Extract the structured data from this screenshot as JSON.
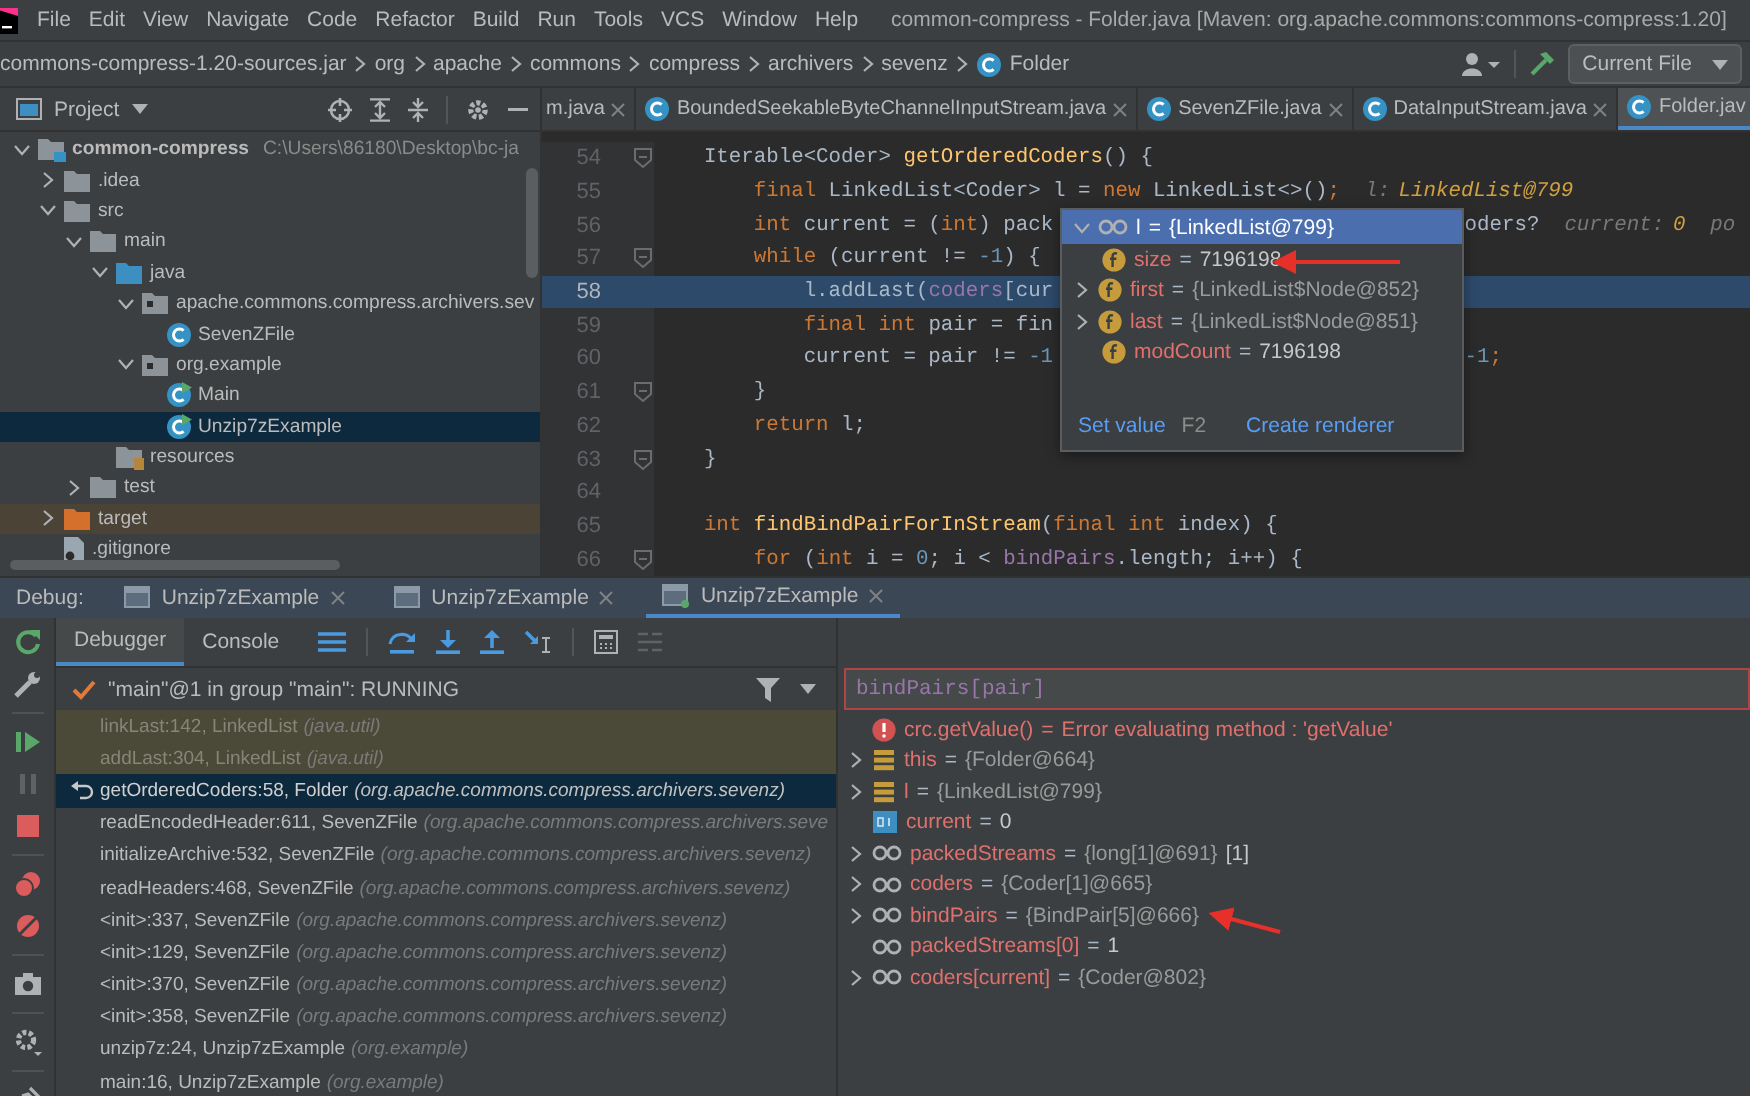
{
  "menu": {
    "items": [
      "File",
      "Edit",
      "View",
      "Navigate",
      "Code",
      "Refactor",
      "Build",
      "Run",
      "Tools",
      "VCS",
      "Window",
      "Help"
    ],
    "title": "common-compress - Folder.java [Maven: org.apache.commons:commons-compress:1.20]"
  },
  "breadcrumbs": [
    {
      "label": "commons-compress-1.20-sources.jar",
      "kind": "jar"
    },
    {
      "label": "org",
      "kind": "package"
    },
    {
      "label": "apache",
      "kind": "package"
    },
    {
      "label": "commons",
      "kind": "package"
    },
    {
      "label": "compress",
      "kind": "package"
    },
    {
      "label": "archivers",
      "kind": "package"
    },
    {
      "label": "sevenz",
      "kind": "package"
    },
    {
      "label": "Folder",
      "kind": "class"
    }
  ],
  "run_config": {
    "label": "Current File"
  },
  "project": {
    "title": "Project",
    "tree": [
      {
        "label": "common-compress",
        "path": "C:\\Users\\86180\\Desktop\\bc-ja",
        "kind": "module",
        "expanded": true,
        "selected": false,
        "children": [
          {
            "label": ".idea",
            "kind": "folder",
            "expanded": false,
            "selected": false
          },
          {
            "label": "src",
            "kind": "folder",
            "expanded": true,
            "selected": false,
            "children": [
              {
                "label": "main",
                "kind": "folder",
                "expanded": true,
                "selected": false,
                "children": [
                  {
                    "label": "java",
                    "kind": "source-root",
                    "expanded": true,
                    "selected": false,
                    "children": [
                      {
                        "label": "apache.commons.compress.archivers.sev",
                        "kind": "package",
                        "expanded": true,
                        "selected": false,
                        "children": [
                          {
                            "label": "SevenZFile",
                            "kind": "class",
                            "selected": false
                          }
                        ]
                      },
                      {
                        "label": "org.example",
                        "kind": "package",
                        "expanded": true,
                        "selected": false,
                        "children": [
                          {
                            "label": "Main",
                            "kind": "runnable-class",
                            "selected": false
                          },
                          {
                            "label": "Unzip7zExample",
                            "kind": "runnable-class",
                            "selected": true
                          }
                        ]
                      }
                    ]
                  },
                  {
                    "label": "resources",
                    "kind": "resources",
                    "selected": false
                  }
                ]
              },
              {
                "label": "test",
                "kind": "folder",
                "expanded": false,
                "selected": false
              }
            ]
          },
          {
            "label": "target",
            "kind": "excluded",
            "expanded": false,
            "selected": false
          },
          {
            "label": ".gitignore",
            "kind": "file",
            "selected": false
          }
        ]
      }
    ]
  },
  "editor_tabs": [
    {
      "label": "m.java",
      "icon_visible": false,
      "selected": false
    },
    {
      "label": "BoundedSeekableByteChannelInputStream.java",
      "icon_visible": true,
      "selected": false
    },
    {
      "label": "SevenZFile.java",
      "icon_visible": true,
      "selected": false
    },
    {
      "label": "DataInputStream.java",
      "icon_visible": true,
      "selected": false
    },
    {
      "label": "Folder.jav",
      "icon_visible": true,
      "selected": true
    }
  ],
  "code_lines": [
    {
      "number": "54",
      "fold": true,
      "execution_point": false,
      "tokens": [
        {
          "text": "    Iterable<Coder> ",
          "kind": "plain"
        },
        {
          "text": "getOrderedCoders",
          "kind": "method"
        },
        {
          "text": "() {",
          "kind": "plain"
        }
      ]
    },
    {
      "number": "55",
      "fold": false,
      "execution_point": false,
      "tokens": [
        {
          "text": "        final",
          "kind": "keyword"
        },
        {
          "text": " LinkedList<Coder> l = ",
          "kind": "plain"
        },
        {
          "text": "new",
          "kind": "keyword"
        },
        {
          "text": " LinkedList<>()",
          "kind": "plain"
        },
        {
          "text": ";",
          "kind": "keyword"
        },
        {
          "text": "l:",
          "kind": "hint"
        },
        {
          "text": "LinkedList@799",
          "kind": "hint-value"
        }
      ]
    },
    {
      "number": "56",
      "fold": false,
      "execution_point": false,
      "tokens": [
        {
          "text": "        int",
          "kind": "keyword"
        },
        {
          "text": " current = (",
          "kind": "plain"
        },
        {
          "text": "int",
          "kind": "keyword"
        },
        {
          "text": ") pack",
          "kind": "plain"
        }
      ],
      "tail": [
        {
          "text": "oders?",
          "kind": "plain"
        },
        {
          "text": "current:",
          "kind": "hint"
        },
        {
          "text": "0",
          "kind": "hint-value"
        },
        {
          "text": "po",
          "kind": "hint"
        }
      ]
    },
    {
      "number": "57",
      "fold": true,
      "execution_point": false,
      "tokens": [
        {
          "text": "        while",
          "kind": "keyword"
        },
        {
          "text": " (current != ",
          "kind": "plain"
        },
        {
          "text": "-1",
          "kind": "number"
        },
        {
          "text": ") {",
          "kind": "plain"
        }
      ]
    },
    {
      "number": "58",
      "fold": false,
      "execution_point": true,
      "tokens": [
        {
          "text": "            l.addLast(",
          "kind": "plain"
        },
        {
          "text": "coders",
          "kind": "field"
        },
        {
          "text": "[cur",
          "kind": "plain"
        }
      ]
    },
    {
      "number": "59",
      "fold": false,
      "execution_point": false,
      "tokens": [
        {
          "text": "            final int",
          "kind": "keyword"
        },
        {
          "text": " pair = fin",
          "kind": "plain"
        }
      ]
    },
    {
      "number": "60",
      "fold": false,
      "execution_point": false,
      "tokens": [
        {
          "text": "            current = pair != ",
          "kind": "plain"
        },
        {
          "text": "-1",
          "kind": "number"
        }
      ],
      "tail": [
        {
          "text": "-1",
          "kind": "number"
        },
        {
          "text": ";",
          "kind": "keyword"
        }
      ]
    },
    {
      "number": "61",
      "fold": true,
      "execution_point": false,
      "tokens": [
        {
          "text": "        }",
          "kind": "plain"
        }
      ]
    },
    {
      "number": "62",
      "fold": false,
      "execution_point": false,
      "tokens": [
        {
          "text": "        return",
          "kind": "keyword"
        },
        {
          "text": " l;",
          "kind": "plain"
        }
      ]
    },
    {
      "number": "63",
      "fold": true,
      "execution_point": false,
      "tokens": [
        {
          "text": "    }",
          "kind": "plain"
        }
      ]
    },
    {
      "number": "64",
      "fold": false,
      "execution_point": false
    },
    {
      "number": "65",
      "fold": false,
      "execution_point": false,
      "tokens": [
        {
          "text": "    int ",
          "kind": "keyword"
        },
        {
          "text": "findBindPairForInStream",
          "kind": "method"
        },
        {
          "text": "(",
          "kind": "plain"
        },
        {
          "text": "final int",
          "kind": "keyword"
        },
        {
          "text": " index) {",
          "kind": "plain"
        }
      ]
    },
    {
      "number": "66",
      "fold": true,
      "execution_point": false,
      "tokens": [
        {
          "text": "        for",
          "kind": "keyword"
        },
        {
          "text": " (",
          "kind": "plain"
        },
        {
          "text": "int",
          "kind": "keyword"
        },
        {
          "text": " i = ",
          "kind": "plain"
        },
        {
          "text": "0",
          "kind": "number"
        },
        {
          "text": "; i < ",
          "kind": "plain"
        },
        {
          "text": "bindPairs",
          "kind": "field"
        },
        {
          "text": ".length; i++) {",
          "kind": "plain"
        }
      ]
    }
  ],
  "popup": {
    "name": "l",
    "separator": "=",
    "value": "{LinkedList@799}",
    "expanded": true,
    "fields": [
      {
        "name": "size",
        "separator": "=",
        "value": "7196198",
        "expandable": false,
        "object": false
      },
      {
        "name": "first",
        "separator": "=",
        "value": "{LinkedList$Node@852}",
        "expandable": true,
        "object": true
      },
      {
        "name": "last",
        "separator": "=",
        "value": "{LinkedList$Node@851}",
        "expandable": true,
        "object": true
      },
      {
        "name": "modCount",
        "separator": "=",
        "value": "7196198",
        "expandable": false,
        "object": false
      }
    ],
    "actions": [
      {
        "label": "Set value",
        "shortcut": "F2"
      },
      {
        "label": "Create renderer"
      }
    ]
  },
  "debug": {
    "label": "Debug:",
    "tabs": [
      {
        "label": "Unzip7zExample",
        "selected": false
      },
      {
        "label": "Unzip7zExample",
        "selected": false
      },
      {
        "label": "Unzip7zExample",
        "selected": true
      }
    ],
    "subtabs": [
      {
        "label": "Debugger",
        "selected": true
      },
      {
        "label": "Console",
        "selected": false
      }
    ],
    "thread": "\"main\"@1 in group \"main\": RUNNING",
    "frames": [
      {
        "location": "linkLast:142, LinkedList",
        "package": "(java.util)",
        "kind": "library",
        "selected": false
      },
      {
        "location": "addLast:304, LinkedList",
        "package": "(java.util)",
        "kind": "library",
        "selected": false
      },
      {
        "location": "getOrderedCoders:58, Folder",
        "package": "(org.apache.commons.compress.archivers.sevenz)",
        "kind": "app",
        "selected": true
      },
      {
        "location": "readEncodedHeader:611, SevenZFile",
        "package": "(org.apache.commons.compress.archivers.seve",
        "kind": "app",
        "selected": false
      },
      {
        "location": "initializeArchive:532, SevenZFile",
        "package": "(org.apache.commons.compress.archivers.sevenz)",
        "kind": "app",
        "selected": false
      },
      {
        "location": "readHeaders:468, SevenZFile",
        "package": "(org.apache.commons.compress.archivers.sevenz)",
        "kind": "app",
        "selected": false
      },
      {
        "location": "<init>:337, SevenZFile",
        "package": "(org.apache.commons.compress.archivers.sevenz)",
        "kind": "app",
        "selected": false
      },
      {
        "location": "<init>:129, SevenZFile",
        "package": "(org.apache.commons.compress.archivers.sevenz)",
        "kind": "app",
        "selected": false
      },
      {
        "location": "<init>:370, SevenZFile",
        "package": "(org.apache.commons.compress.archivers.sevenz)",
        "kind": "app",
        "selected": false
      },
      {
        "location": "<init>:358, SevenZFile",
        "package": "(org.apache.commons.compress.archivers.sevenz)",
        "kind": "app",
        "selected": false
      },
      {
        "location": "unzip7z:24, Unzip7zExample",
        "package": "(org.example)",
        "kind": "app",
        "selected": false
      },
      {
        "location": "main:16, Unzip7zExample",
        "package": "(org.example)",
        "kind": "app",
        "selected": false
      }
    ],
    "watch": "bindPairs[pair]",
    "variables": [
      {
        "name": "crc.getValue()",
        "separator": "=",
        "value": "Error evaluating method : 'getValue'",
        "kind": "error",
        "expandable": false
      },
      {
        "name": "this",
        "separator": "=",
        "value": "{Folder@664}",
        "kind": "local",
        "object": true,
        "expandable": true
      },
      {
        "name": "l",
        "separator": "=",
        "value": "{LinkedList@799}",
        "kind": "local",
        "object": true,
        "expandable": true
      },
      {
        "name": "current",
        "separator": "=",
        "value": "0",
        "kind": "primitive",
        "object": false,
        "expandable": false
      },
      {
        "name": "packedStreams",
        "separator": "=",
        "value": "{long[1]@691}",
        "extra": "[1]",
        "kind": "watch",
        "object": true,
        "expandable": true
      },
      {
        "name": "coders",
        "separator": "=",
        "value": "{Coder[1]@665}",
        "kind": "watch",
        "object": true,
        "expandable": true
      },
      {
        "name": "bindPairs",
        "separator": "=",
        "value": "{BindPair[5]@666}",
        "kind": "watch",
        "object": true,
        "expandable": true
      },
      {
        "name": "packedStreams[0]",
        "separator": "=",
        "value": "1",
        "kind": "watch",
        "object": false,
        "expandable": false
      },
      {
        "name": "coders[current]",
        "separator": "=",
        "value": "{Coder@802}",
        "kind": "watch",
        "object": true,
        "expandable": true
      }
    ]
  }
}
